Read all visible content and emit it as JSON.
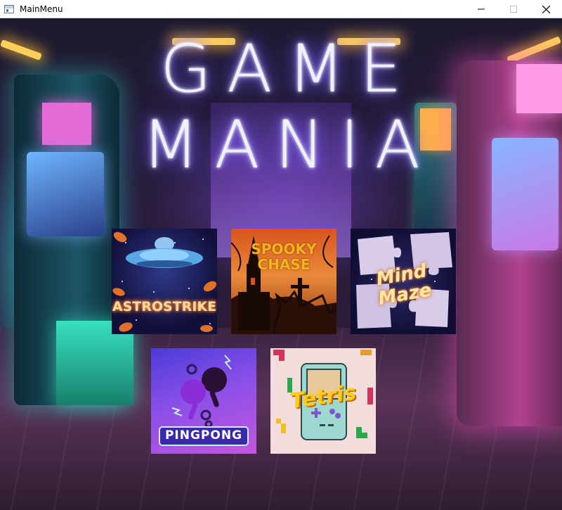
{
  "window": {
    "title": "MainMenu",
    "controls": {
      "minimize_icon": "minimize-icon",
      "maximize_icon": "maximize-icon",
      "close_icon": "close-icon"
    }
  },
  "menu": {
    "title_line1": "GAME",
    "title_line2": "MANIA",
    "games": [
      {
        "label": "ASTROSTRIKE",
        "art_icon": "ufo-icon"
      },
      {
        "label_line1": "SPOOKY",
        "label_line2": "CHASE",
        "art_icon": "haunted-church-icon"
      },
      {
        "label_line1": "Mind",
        "label_line2": "Maze",
        "art_icon": "puzzle-pieces-icon"
      },
      {
        "label": "PINGPONG",
        "art_icon": "ping-pong-paddles-icon"
      },
      {
        "label": "Tetris",
        "art_icon": "handheld-console-icon"
      }
    ]
  },
  "colors": {
    "neon_glow": "#7f5cff",
    "astro_text": "#ffd9a0",
    "spooky_text": "#f3b51d",
    "mind_text": "#ffe7a8",
    "tetris_text": "#f6cf1d"
  }
}
